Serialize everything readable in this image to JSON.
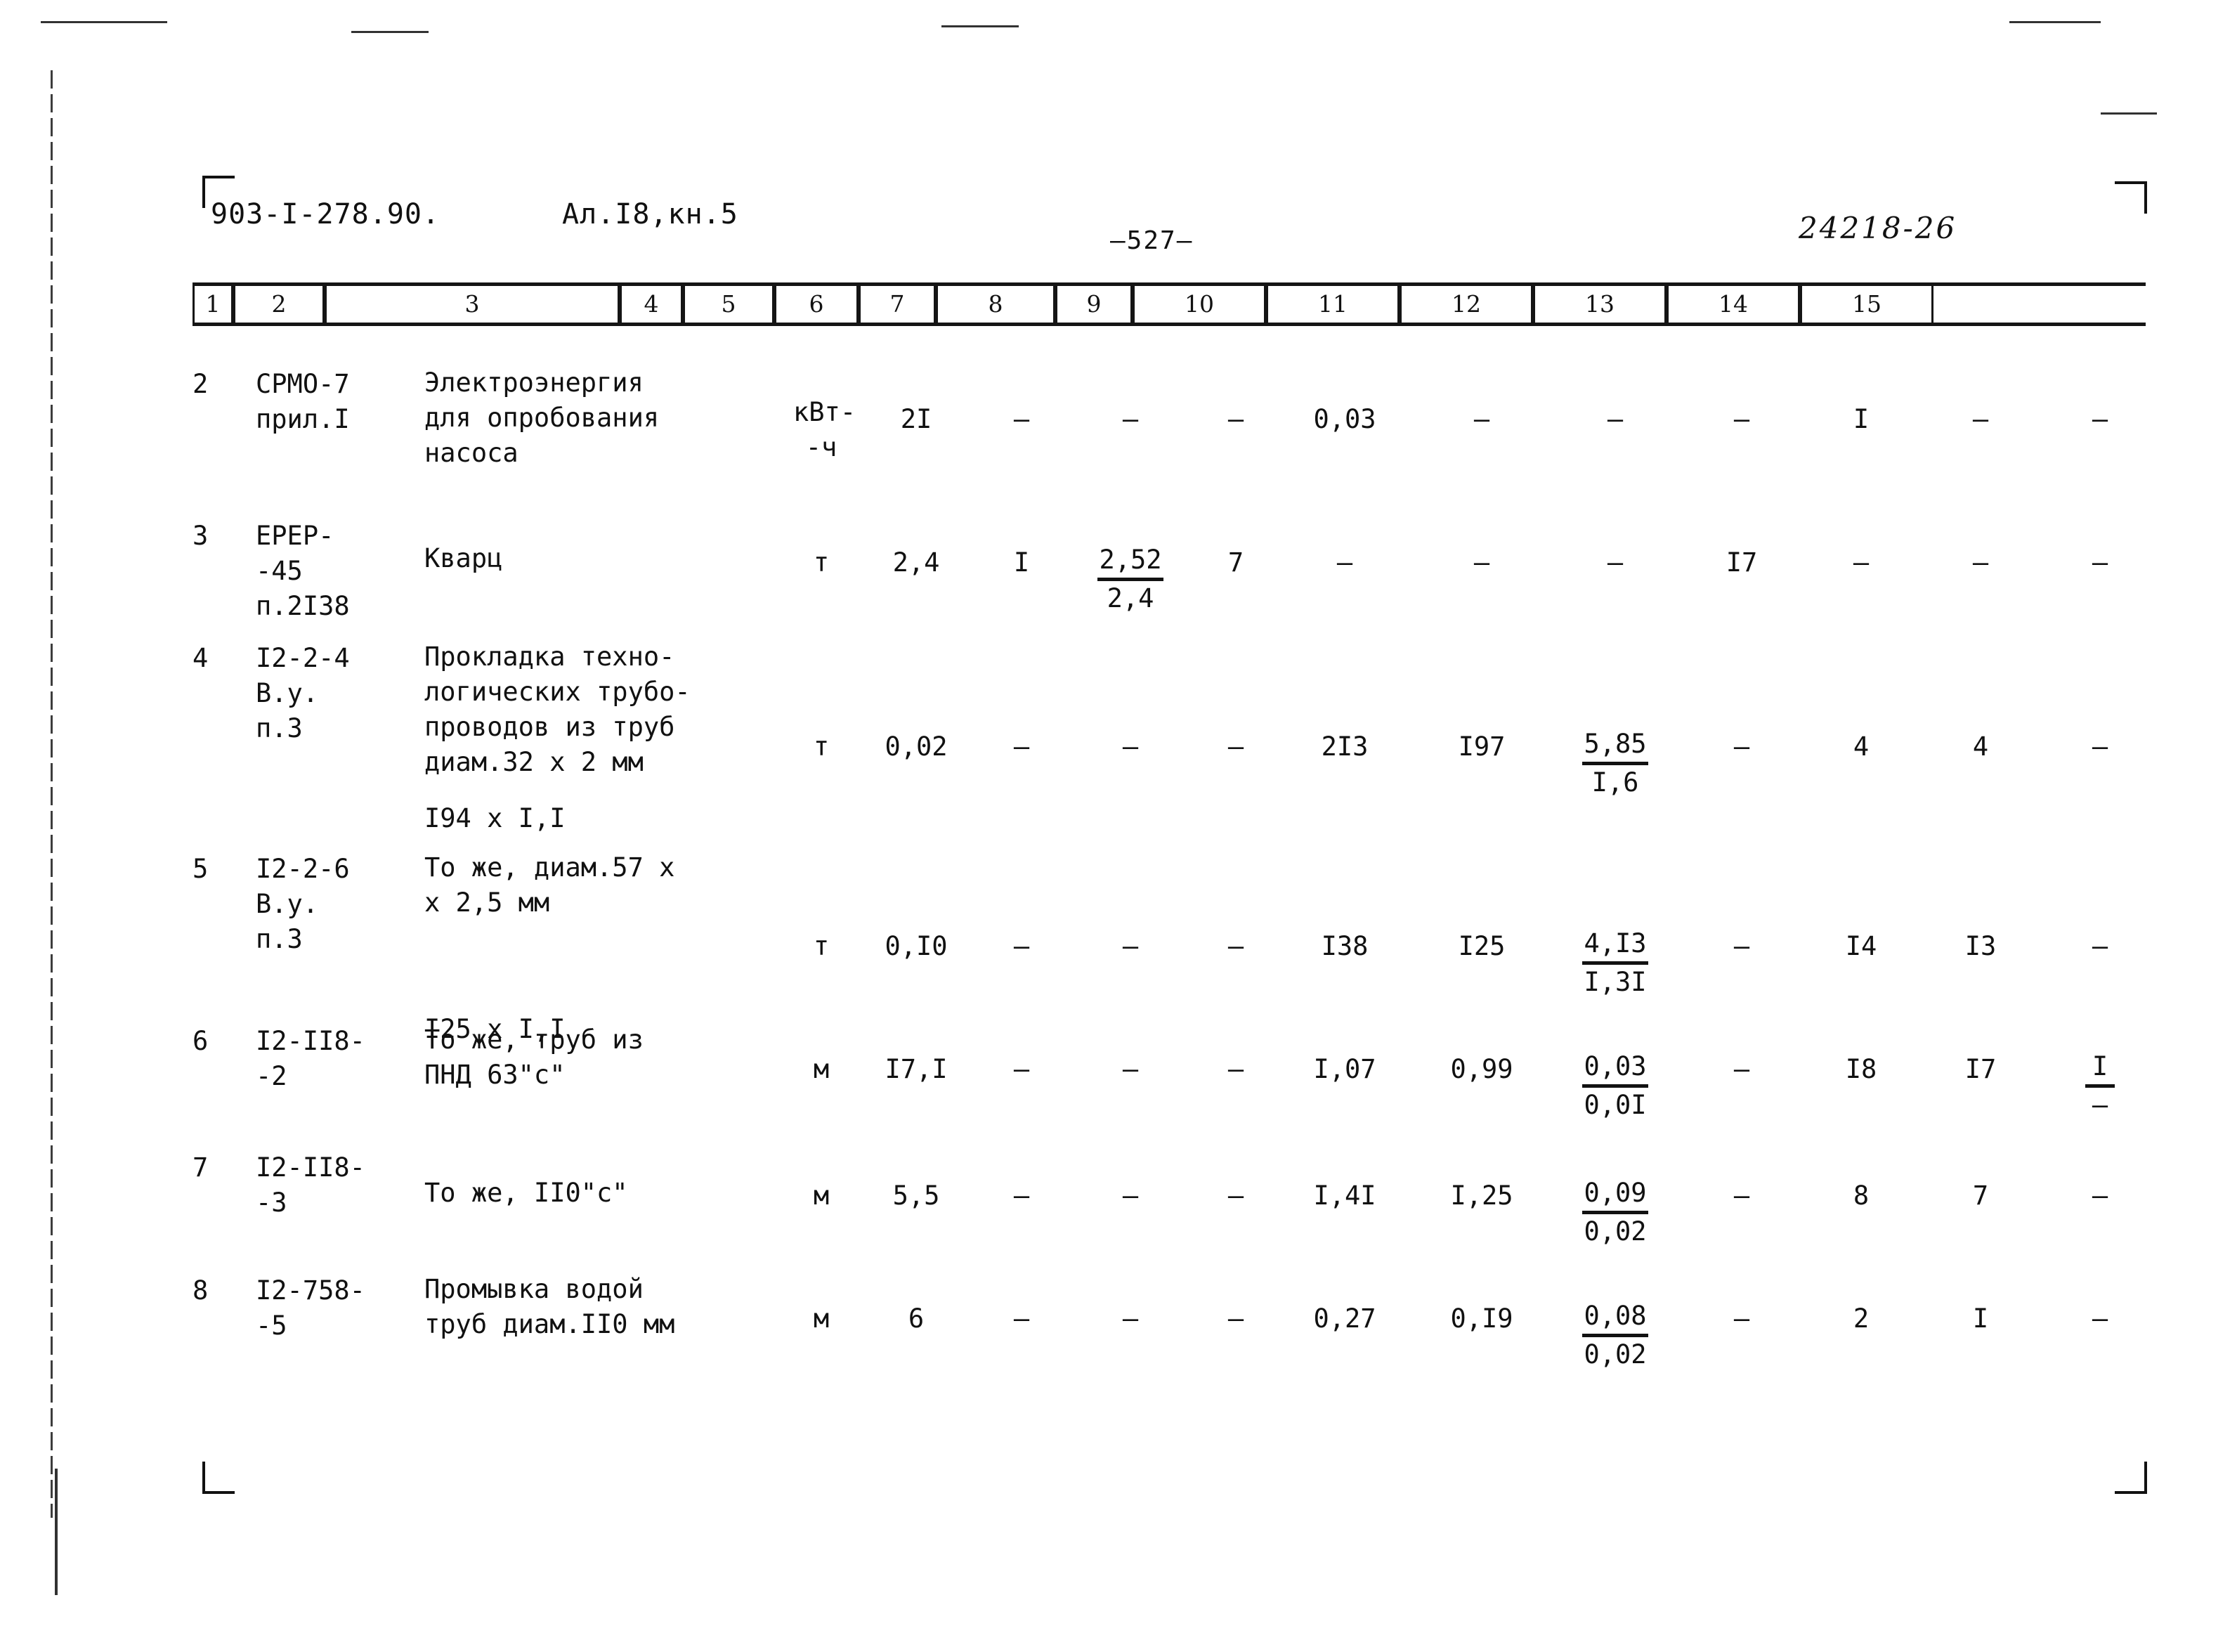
{
  "header": {
    "doc_code": "903-I-278.90.",
    "album_code": "Ал.I8,кн.5",
    "page_number": "—527—",
    "archive_number": "24218-26"
  },
  "column_numbers": [
    "1",
    "2",
    "3",
    "4",
    "5",
    "6",
    "7",
    "8",
    "9",
    "10",
    "11",
    "12",
    "13",
    "14",
    "15"
  ],
  "rows": [
    {
      "num": "2",
      "code": "СРМО-7\nприл.I",
      "name": "Электроэнергия\nдля опробования\nнасоса",
      "unit": "кВт-\n-ч",
      "c5": "2I",
      "c6": "–",
      "c7": "–",
      "c8": "–",
      "c9": "0,03",
      "c10": "–",
      "c11": "–",
      "c12": "–",
      "c13": "I",
      "c14": "–",
      "c15": "–"
    },
    {
      "num": "3",
      "code": "ЕРЕР-\n-45\nп.2I38",
      "name": "Кварц",
      "unit": "т",
      "c5": "2,4",
      "c6": "I",
      "c7_top": "2,52",
      "c7_bot": "2,4",
      "c8": "7",
      "c9": "–",
      "c10": "–",
      "c11": "–",
      "c12": "I7",
      "c13": "–",
      "c14": "–",
      "c15": "–"
    },
    {
      "num": "4",
      "code": "I2-2-4\nВ.у.\nп.3",
      "name": "Прокладка техно-\nлогических трубо-\nпроводов из труб\nдиам.32 х 2 мм",
      "name_extra": "I94 х I,I",
      "unit": "т",
      "c5": "0,02",
      "c6": "–",
      "c7": "–",
      "c8": "–",
      "c9": "2I3",
      "c10": "I97",
      "c11_top": "5,85",
      "c11_bot": "I,6",
      "c12": "–",
      "c13": "4",
      "c14": "4",
      "c15": "–"
    },
    {
      "num": "5",
      "code": "I2-2-6\nВ.у.\nп.3",
      "name": "То же, диам.57 х\nх 2,5 мм",
      "name_extra": "I25 х I,I",
      "unit": "т",
      "c5": "0,I0",
      "c6": "–",
      "c7": "–",
      "c8": "–",
      "c9": "I38",
      "c10": "I25",
      "c11_top": "4,I3",
      "c11_bot": "I,3I",
      "c12": "–",
      "c13": "I4",
      "c14": "I3",
      "c15": "–"
    },
    {
      "num": "6",
      "code": "I2-II8-\n-2",
      "name": "То же, труб из\nПНД 63\"с\"",
      "unit": "м",
      "c5": "I7,I",
      "c6": "–",
      "c7": "–",
      "c8": "–",
      "c9": "I,07",
      "c10": "0,99",
      "c11_top": "0,03",
      "c11_bot": "0,0I",
      "c12": "–",
      "c13": "I8",
      "c14": "I7",
      "c15_top": "I",
      "c15_bot": "–"
    },
    {
      "num": "7",
      "code": "I2-II8-\n-3",
      "name": "То же, II0\"с\"",
      "unit": "м",
      "c5": "5,5",
      "c6": "–",
      "c7": "–",
      "c8": "–",
      "c9": "I,4I",
      "c10": "I,25",
      "c11_top": "0,09",
      "c11_bot": "0,02",
      "c12": "–",
      "c13": "8",
      "c14": "7",
      "c15": "–"
    },
    {
      "num": "8",
      "code": "I2-758-\n-5",
      "name": "Промывка водой\nтруб диам.II0 мм",
      "unit": "м",
      "c5": "6",
      "c6": "–",
      "c7": "–",
      "c8": "–",
      "c9": "0,27",
      "c10": "0,I9",
      "c11_top": "0,08",
      "c11_bot": "0,02",
      "c12": "–",
      "c13": "2",
      "c14": "I",
      "c15": "–"
    }
  ]
}
